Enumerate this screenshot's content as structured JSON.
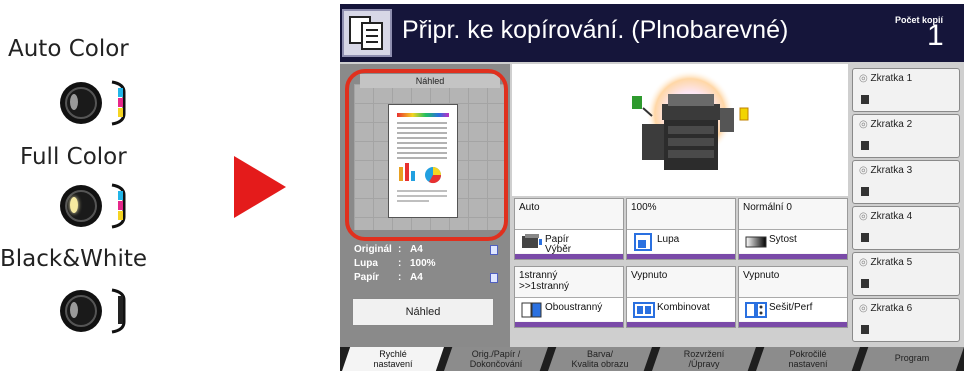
{
  "legend": {
    "modes": [
      {
        "label": "Auto Color",
        "state": "dim"
      },
      {
        "label": "Full Color",
        "state": "on"
      },
      {
        "label": "Black&White",
        "state": "dim"
      }
    ]
  },
  "colors": {
    "arrow": "#e41b1b",
    "highlight_ring": "#e0301e",
    "titlebar": "#15153a",
    "accent_bar": "#7a4aa8"
  },
  "panel": {
    "title": "Připr. ke kopírování. (Plnobarevné)",
    "copies_label": "Počet kopií",
    "copies_value": "1",
    "preview": {
      "header": "Náhled",
      "original_label": "Originál",
      "original_value": "A4",
      "zoom_label": "Lupa",
      "zoom_value": "100%",
      "paper_label": "Papír",
      "paper_value": "A4",
      "preview_button": "Náhled"
    },
    "functions": [
      {
        "top": "Auto",
        "label": "Papír\nVýběr",
        "icon": "paper-tray-icon"
      },
      {
        "top": "100%",
        "label": "Lupa",
        "icon": "zoom-icon"
      },
      {
        "top": "Normální 0",
        "label": "Sytost",
        "icon": "density-icon"
      },
      {
        "top": "1stranný\n>>1stranný",
        "label": "Oboustranný",
        "icon": "duplex-icon"
      },
      {
        "top": "Vypnuto",
        "label": "Kombinovat",
        "icon": "combine-icon"
      },
      {
        "top": "Vypnuto",
        "label": "Sešit/Perf",
        "icon": "staple-punch-icon"
      }
    ],
    "shortcuts": [
      "Zkratka 1",
      "Zkratka 2",
      "Zkratka 3",
      "Zkratka 4",
      "Zkratka 5",
      "Zkratka 6"
    ],
    "tabs": [
      {
        "label": "Rychlé\nnastavení",
        "active": true
      },
      {
        "label": "Orig./Papír /\nDokončování",
        "active": false
      },
      {
        "label": "Barva/\nKvalita obrazu",
        "active": false
      },
      {
        "label": "Rozvržení\n/Úpravy",
        "active": false
      },
      {
        "label": "Pokročilé\nnastavení",
        "active": false
      },
      {
        "label": "Program",
        "active": false
      }
    ]
  }
}
